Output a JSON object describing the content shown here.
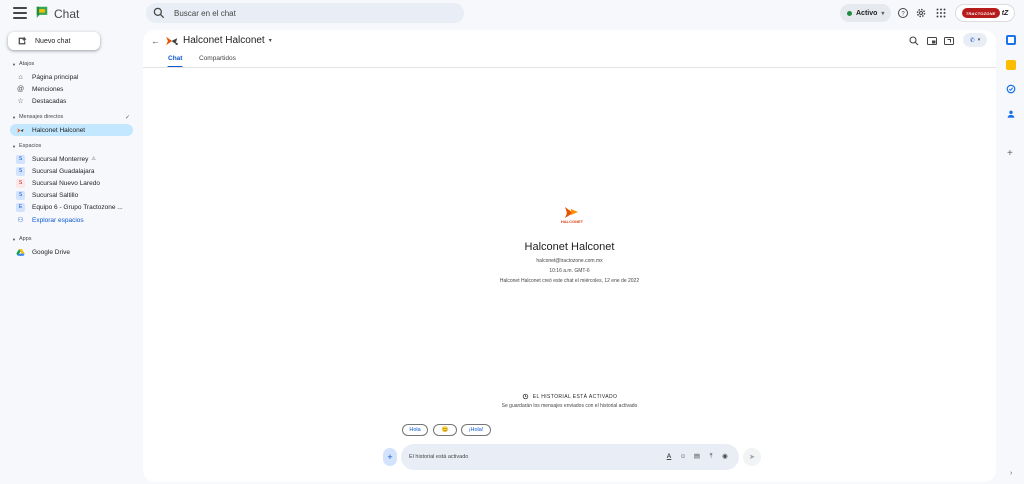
{
  "app": {
    "title": "Chat"
  },
  "search": {
    "placeholder": "Buscar en el chat"
  },
  "status": {
    "label": "Activo",
    "color": "#1e8e3e"
  },
  "account": {
    "brand_text": "TRACTOZONE",
    "brand_mark": "tZ"
  },
  "sidebar": {
    "new_chat_label": "Nuevo chat",
    "shortcuts": {
      "heading": "Atajos",
      "items": [
        {
          "label": "Página principal",
          "icon": "home-icon"
        },
        {
          "label": "Menciones",
          "icon": "at-icon"
        },
        {
          "label": "Destacadas",
          "icon": "star-icon"
        }
      ]
    },
    "direct_messages": {
      "heading": "Mensajes directos",
      "items": [
        {
          "label": "Halconet Halconet",
          "active": true
        }
      ]
    },
    "spaces": {
      "heading": "Espacios",
      "items": [
        {
          "label": "Sucursal Monterrey",
          "initial": "S",
          "suffix": "⚠"
        },
        {
          "label": "Sucursal Guadalajara",
          "initial": "S"
        },
        {
          "label": "Sucursal Nuevo Laredo",
          "initial": "S"
        },
        {
          "label": "Sucursal Saltillo",
          "initial": "S"
        },
        {
          "label": "Equipo 6  - Grupo Tractozone ...",
          "initial": "E"
        }
      ],
      "explore_label": "Explorar espacios"
    },
    "apps": {
      "heading": "Apps",
      "items": [
        {
          "label": "Google Drive",
          "icon": "drive-icon"
        }
      ]
    }
  },
  "conversation": {
    "title": "Halconet Halconet",
    "tabs": [
      {
        "label": "Chat",
        "active": true
      },
      {
        "label": "Compartidos",
        "active": false
      }
    ],
    "intro": {
      "logo_text": "HALCONET",
      "name": "Halconet Halconet",
      "email": "halconet@tractozone.com.mx",
      "time": "10:16 a.m. GMT-6",
      "created": "Halconet Halconet creó este chat el miércoles, 12 ene de 2022"
    },
    "history": {
      "title": "EL HISTORIAL ESTÁ ACTIVADO",
      "subtitle": "Se guardarán los mensajes enviados con el historial activado"
    },
    "quick_replies": [
      "Hola",
      "😊",
      "¡Hola!"
    ],
    "composer": {
      "placeholder": "El historial está activado"
    }
  },
  "colors": {
    "accent": "#0b57d0",
    "active_item": "#c2e7ff",
    "background": "#f6f8fc",
    "brand_red": "#b71c1c"
  }
}
